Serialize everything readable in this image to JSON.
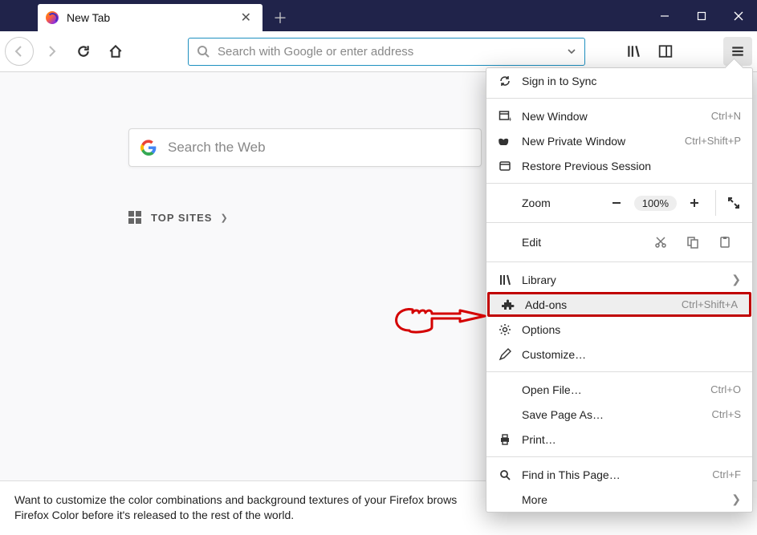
{
  "tab": {
    "title": "New Tab"
  },
  "urlbar": {
    "placeholder": "Search with Google or enter address"
  },
  "content": {
    "search_placeholder": "Search the Web",
    "topsites_label": "TOP SITES"
  },
  "snippet": {
    "line1": "Want to customize the color combinations and background textures of your Firefox brows",
    "line2": "Firefox Color before it's released to the rest of the world."
  },
  "menu": {
    "sign_in": "Sign in to Sync",
    "new_window": {
      "label": "New Window",
      "shortcut": "Ctrl+N"
    },
    "new_private": {
      "label": "New Private Window",
      "shortcut": "Ctrl+Shift+P"
    },
    "restore": "Restore Previous Session",
    "zoom_label": "Zoom",
    "zoom_value": "100%",
    "edit_label": "Edit",
    "library": "Library",
    "addons": {
      "label": "Add-ons",
      "shortcut": "Ctrl+Shift+A"
    },
    "options": "Options",
    "customize": "Customize…",
    "open_file": {
      "label": "Open File…",
      "shortcut": "Ctrl+O"
    },
    "save_page": {
      "label": "Save Page As…",
      "shortcut": "Ctrl+S"
    },
    "print": "Print…",
    "find": {
      "label": "Find in This Page…",
      "shortcut": "Ctrl+F"
    },
    "more": "More"
  }
}
